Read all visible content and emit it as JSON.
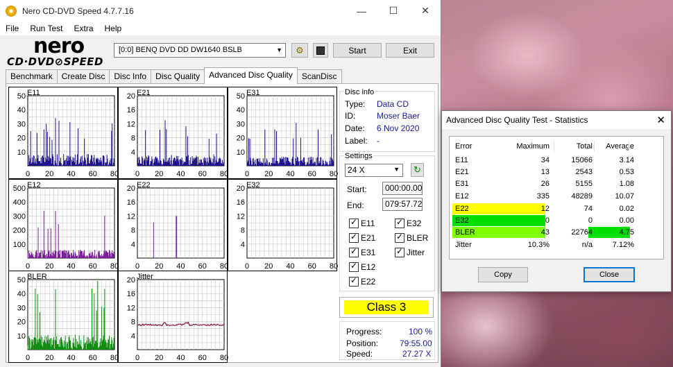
{
  "window": {
    "title": "Nero CD-DVD Speed 4.7.7.16",
    "min": "—",
    "max": "☐",
    "close": "✕"
  },
  "menu": [
    "File",
    "Run Test",
    "Extra",
    "Help"
  ],
  "logo": {
    "line1": "nero",
    "line2": "CD·DVD⊘SPEED"
  },
  "toolbar": {
    "drive": "[0:0]   BENQ DVD DD DW1640 BSLB",
    "start": "Start",
    "exit": "Exit"
  },
  "tabs": [
    "Benchmark",
    "Create Disc",
    "Disc Info",
    "Disc Quality",
    "Advanced Disc Quality",
    "ScanDisc"
  ],
  "active_tab": 4,
  "disc_info": {
    "title": "Disc info",
    "type_label": "Type:",
    "type": "Data CD",
    "id_label": "ID:",
    "id": "Moser Baer",
    "date_label": "Date:",
    "date": "6 Nov 2020",
    "label_label": "Label:",
    "label": "-"
  },
  "settings": {
    "title": "Settings",
    "speed": "24 X",
    "start_label": "Start:",
    "start": "000:00.00",
    "end_label": "End:",
    "end": "079:57.72",
    "checks": [
      "E11",
      "E32",
      "E21",
      "BLER",
      "E31",
      "Jitter",
      "E12",
      "E22"
    ]
  },
  "class_label": "Class 3",
  "progress": {
    "progress_label": "Progress:",
    "progress": "100 %",
    "position_label": "Position:",
    "position": "79:55.00",
    "speed_label": "Speed:",
    "speed": "27.27 X"
  },
  "colors": {
    "blue_series": "#1a0f8c",
    "purple_series": "#7a1a9a",
    "green_series": "#0e8a0e",
    "jitter_series": "#8a0a2a",
    "class_bg": "#ffff00"
  },
  "chart_data": [
    {
      "type": "bar",
      "title": "E11",
      "x_ticks": [
        "0",
        "20",
        "40",
        "60",
        "80"
      ],
      "y_ticks": [
        "10",
        "20",
        "30",
        "40",
        "50"
      ],
      "ylim": [
        0,
        50
      ],
      "xlim": [
        0,
        80
      ],
      "peak": 34
    },
    {
      "type": "bar",
      "title": "E21",
      "x_ticks": [
        "0",
        "20",
        "40",
        "60",
        "80"
      ],
      "y_ticks": [
        "4",
        "8",
        "12",
        "16",
        "20"
      ],
      "ylim": [
        0,
        20
      ],
      "xlim": [
        0,
        80
      ],
      "peak": 13
    },
    {
      "type": "bar",
      "title": "E31",
      "x_ticks": [
        "0",
        "20",
        "40",
        "60",
        "80"
      ],
      "y_ticks": [
        "10",
        "20",
        "30",
        "40",
        "50"
      ],
      "ylim": [
        0,
        50
      ],
      "xlim": [
        0,
        80
      ],
      "peak": 26
    },
    {
      "type": "bar",
      "title": "E12",
      "x_ticks": [
        "0",
        "20",
        "40",
        "60",
        "80"
      ],
      "y_ticks": [
        "100",
        "200",
        "300",
        "400",
        "500"
      ],
      "ylim": [
        0,
        500
      ],
      "xlim": [
        0,
        80
      ],
      "peak": 335
    },
    {
      "type": "bar",
      "title": "E22",
      "x_ticks": [
        "0",
        "20",
        "40",
        "60",
        "80"
      ],
      "y_ticks": [
        "4",
        "8",
        "12",
        "16",
        "20"
      ],
      "ylim": [
        0,
        20
      ],
      "xlim": [
        0,
        80
      ],
      "peak": 12
    },
    {
      "type": "bar",
      "title": "E32",
      "x_ticks": [
        "0",
        "20",
        "40",
        "60",
        "80"
      ],
      "y_ticks": [
        "4",
        "8",
        "12",
        "16",
        "20"
      ],
      "ylim": [
        0,
        20
      ],
      "xlim": [
        0,
        80
      ],
      "peak": 0
    },
    {
      "type": "bar",
      "title": "BLER",
      "x_ticks": [
        "0",
        "20",
        "40",
        "60",
        "80"
      ],
      "y_ticks": [
        "10",
        "20",
        "30",
        "40",
        "50"
      ],
      "ylim": [
        0,
        50
      ],
      "xlim": [
        0,
        80
      ],
      "peak": 43
    },
    {
      "type": "line",
      "title": "Jitter",
      "x_ticks": [
        "0",
        "20",
        "40",
        "60",
        "80"
      ],
      "y_ticks": [
        "4",
        "8",
        "12",
        "16",
        "20"
      ],
      "ylim": [
        0,
        20
      ],
      "xlim": [
        0,
        80
      ],
      "level": 7.1
    }
  ],
  "stats": {
    "title": "Advanced Disc Quality Test - Statistics",
    "headers": [
      "Error",
      "Maximum",
      "Total",
      "Average"
    ],
    "rows": [
      [
        "E11",
        "34",
        "15066",
        "3.14"
      ],
      [
        "E21",
        "13",
        "2543",
        "0.53"
      ],
      [
        "E31",
        "26",
        "5155",
        "1.08"
      ],
      [
        "E12",
        "335",
        "48289",
        "10.07"
      ],
      [
        "E22",
        "12",
        "74",
        "0.02"
      ],
      [
        "E32",
        "0",
        "0",
        "0.00"
      ],
      [
        "BLER",
        "43",
        "22764",
        "4.75"
      ],
      [
        "Jitter",
        "10.3%",
        "n/a",
        "7.12%"
      ]
    ],
    "copy": "Copy",
    "close": "Close"
  }
}
